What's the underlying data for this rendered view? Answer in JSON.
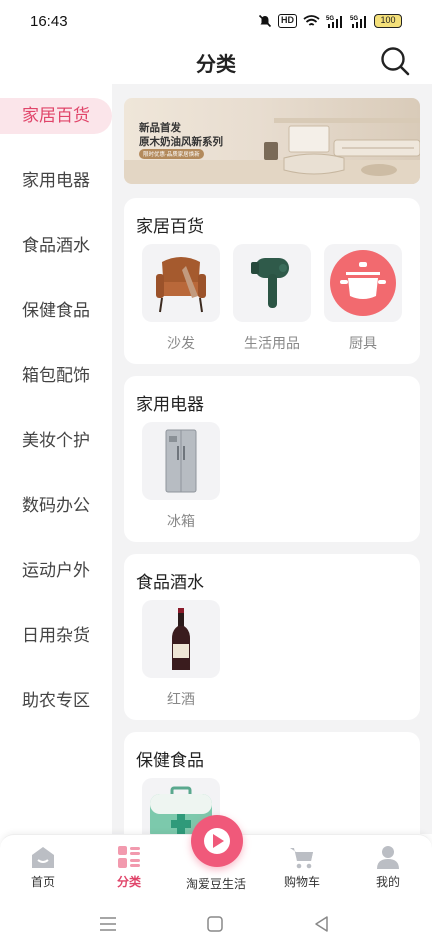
{
  "status_bar": {
    "time": "16:43",
    "battery": "100",
    "hd": "HD",
    "signal_label": "5G"
  },
  "header": {
    "title": "分类"
  },
  "sidebar": {
    "items": [
      {
        "label": "家居百货",
        "active": true
      },
      {
        "label": "家用电器"
      },
      {
        "label": "食品酒水"
      },
      {
        "label": "保健食品"
      },
      {
        "label": "箱包配饰"
      },
      {
        "label": "美妆个护"
      },
      {
        "label": "数码办公"
      },
      {
        "label": "运动户外"
      },
      {
        "label": "日用杂货"
      },
      {
        "label": "助农专区"
      }
    ]
  },
  "banner": {
    "line1": "新品首发",
    "line2": "原木奶油风新系列",
    "tag": "限时优惠·品质家居焕新"
  },
  "sections": [
    {
      "title": "家居百货",
      "items": [
        {
          "label": "沙发",
          "icon": "armchair-icon"
        },
        {
          "label": "生活用品",
          "icon": "hair-dryer-icon"
        },
        {
          "label": "厨具",
          "icon": "cooking-pot-icon"
        }
      ]
    },
    {
      "title": "家用电器",
      "items": [
        {
          "label": "冰箱",
          "icon": "refrigerator-icon"
        }
      ]
    },
    {
      "title": "食品酒水",
      "items": [
        {
          "label": "红酒",
          "icon": "wine-bottle-icon"
        }
      ]
    },
    {
      "title": "保健食品",
      "items": [
        {
          "label": "",
          "icon": "medical-kit-icon"
        }
      ]
    }
  ],
  "bottom_nav": {
    "items": [
      {
        "label": "首页",
        "icon": "home-icon"
      },
      {
        "label": "分类",
        "icon": "category-icon",
        "active": true
      },
      {
        "label": "淘爱豆生活",
        "icon": "play-icon"
      },
      {
        "label": "购物车",
        "icon": "cart-icon"
      },
      {
        "label": "我的",
        "icon": "user-icon"
      }
    ]
  },
  "colors": {
    "accent": "#e0456a",
    "accent_light": "#fbe5ea",
    "fab": "#f0597a",
    "panel_bg": "#f3f3f4"
  }
}
